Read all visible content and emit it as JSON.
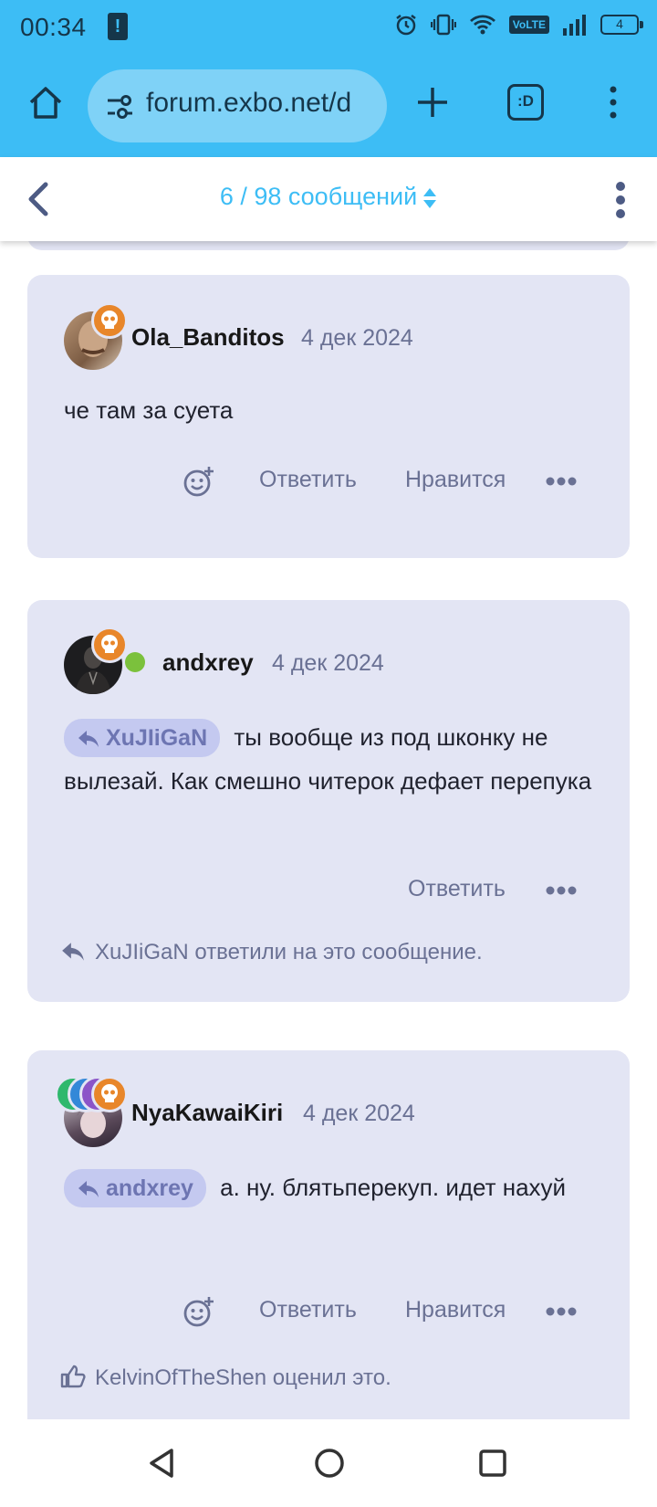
{
  "status_bar": {
    "time": "00:34",
    "volte": "VoLTE",
    "battery": "4"
  },
  "browser": {
    "url": "forum.exbo.net/d",
    "tabs_label": ":D"
  },
  "topic_nav": {
    "counter": "6 / 98 сообщений"
  },
  "posts": [
    {
      "username": "Ola_Banditos",
      "date": "4 дек 2024",
      "text": "че там за суета",
      "actions": {
        "reply": "Ответить",
        "like": "Нравится"
      }
    },
    {
      "username": "andxrey",
      "date": "4 дек 2024",
      "mention": "XuJIiGaN",
      "text": "ты вообще из под шконку не вылезай. Как смешно читерок дефает перепука",
      "actions": {
        "reply": "Ответить"
      },
      "footnote": "XuJIiGaN ответили на это сообщение."
    },
    {
      "username": "NyaKawaiKiri",
      "date": "4 дек 2024",
      "mention": "andxrey",
      "text": "а. ну. блятьперекуп. идет нахуй",
      "actions": {
        "reply": "Ответить",
        "like": "Нравится"
      },
      "footnote": "KelvinOfTheShen оценил это."
    }
  ],
  "colors": {
    "accent": "#3dbdf5",
    "post_bg": "#e3e5f4",
    "badge": "#e8862a",
    "online": "#7bc13c"
  }
}
